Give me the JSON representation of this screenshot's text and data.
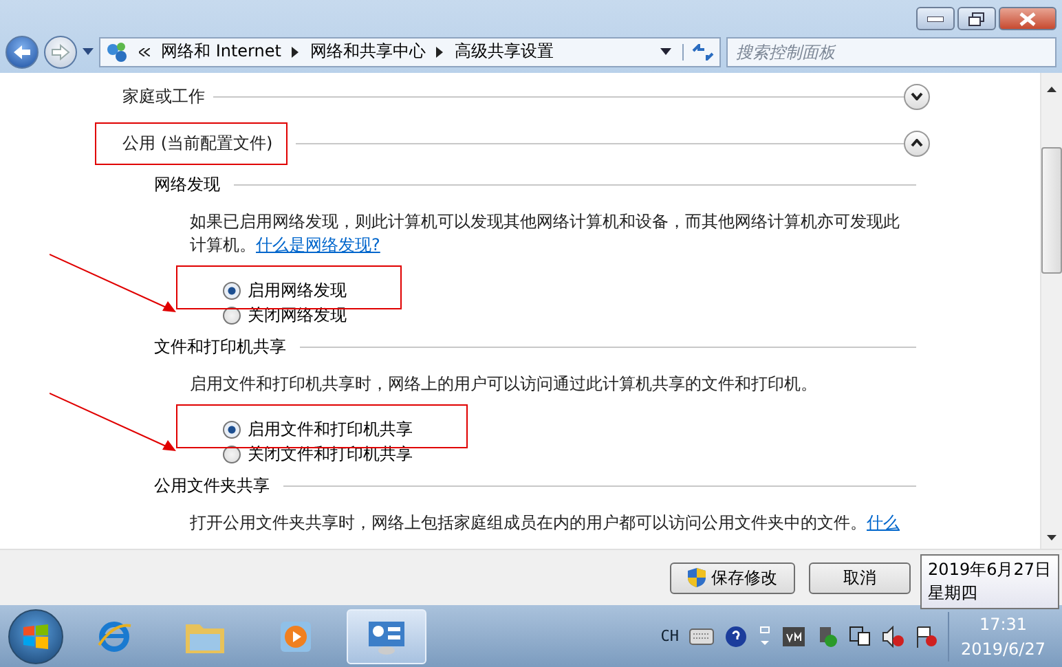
{
  "window": {
    "breadcrumb": [
      "网络和 Internet",
      "网络和共享中心",
      "高级共享设置"
    ],
    "search": {
      "placeholder": "搜索控制面板"
    }
  },
  "profiles": [
    {
      "title": "家庭或工作",
      "expanded": false,
      "annotated": false
    },
    {
      "title": "公用 (当前配置文件)",
      "expanded": true,
      "annotated": true
    }
  ],
  "sections": [
    {
      "title": "网络发现",
      "text": "如果已启用网络发现，则此计算机可以发现其他网络计算机和设备，而其他网络计算机亦可发现此计算机。",
      "link": "什么是网络发现?",
      "annotated": true,
      "options": [
        {
          "label": "启用网络发现",
          "selected": true
        },
        {
          "label": "关闭网络发现",
          "selected": false
        }
      ]
    },
    {
      "title": "文件和打印机共享",
      "text": "启用文件和打印机共享时，网络上的用户可以访问通过此计算机共享的文件和打印机。",
      "annotated": true,
      "options": [
        {
          "label": "启用文件和打印机共享",
          "selected": true
        },
        {
          "label": "关闭文件和打印机共享",
          "selected": false
        }
      ]
    },
    {
      "title": "公用文件夹共享",
      "text": "打开公用文件夹共享时，网络上包括家庭组成员在内的用户都可以访问公用文件夹中的文件。",
      "link": "什么",
      "annotated": false
    }
  ],
  "buttons": [
    {
      "label": "保存修改",
      "shield": true
    },
    {
      "label": "取消",
      "shield": false
    }
  ],
  "tooltip": {
    "date": "2019年6月27日",
    "weekday": "星期四"
  },
  "taskbar": {
    "apps": [
      {
        "kind": "browser",
        "active": false
      },
      {
        "kind": "folder",
        "active": false
      },
      {
        "kind": "media",
        "active": false
      },
      {
        "kind": "control",
        "active": true
      }
    ],
    "language": "CH",
    "time": "17:31",
    "date": "2019/6/27"
  }
}
